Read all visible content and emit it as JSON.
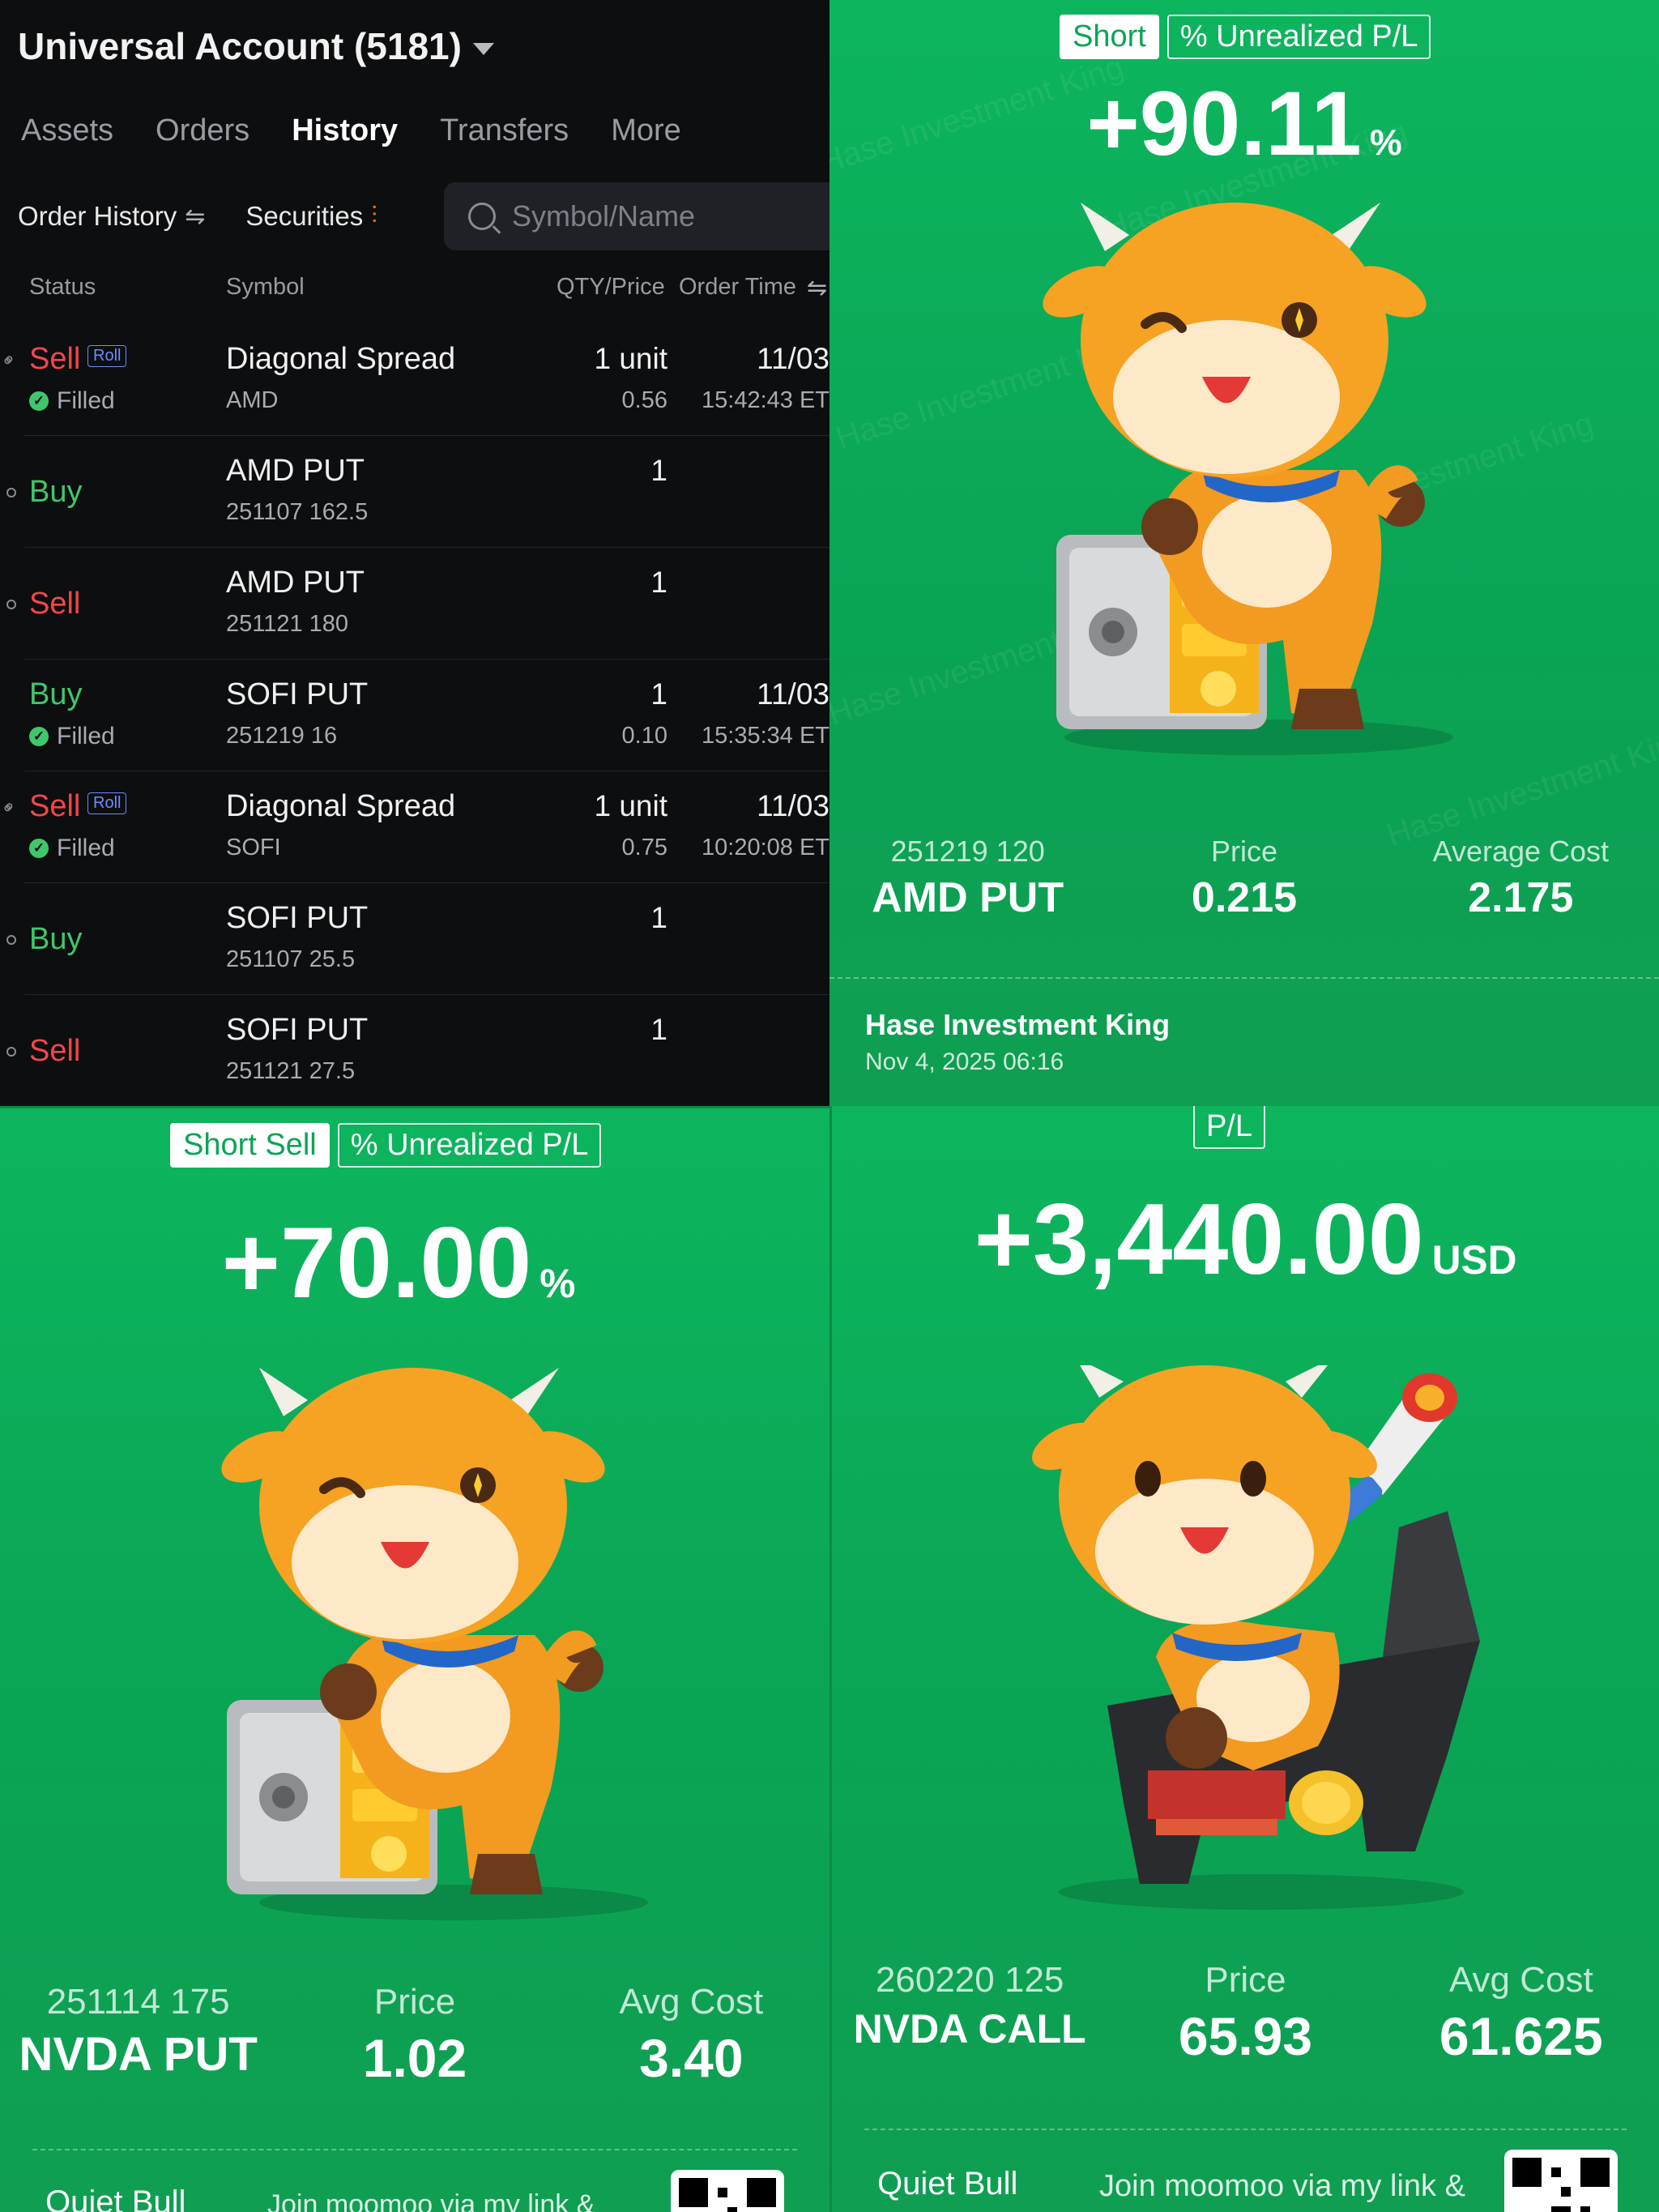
{
  "history": {
    "account_title": "Universal Account (5181)",
    "tabs": [
      "Assets",
      "Orders",
      "History",
      "Transfers",
      "More"
    ],
    "active_tab": "History",
    "filter_order": "Order History",
    "filter_securities": "Securities",
    "search_placeholder": "Symbol/Name",
    "columns": {
      "status": "Status",
      "symbol": "Symbol",
      "qty_price": "QTY/Price",
      "order_time": "Order Time"
    },
    "rows": [
      {
        "side": "Sell",
        "roll": "Roll",
        "status": "Filled",
        "symbol": "Diagonal Spread",
        "sub": "AMD",
        "qty": "1 unit",
        "price": "0.56",
        "date": "11/03",
        "time": "15:42:43 ET"
      },
      {
        "side": "Buy",
        "roll": "",
        "status": "",
        "symbol": "AMD PUT",
        "sub": "251107 162.5",
        "qty": "1",
        "price": "",
        "date": "",
        "time": ""
      },
      {
        "side": "Sell",
        "roll": "",
        "status": "",
        "symbol": "AMD PUT",
        "sub": "251121 180",
        "qty": "1",
        "price": "",
        "date": "",
        "time": ""
      },
      {
        "side": "Buy",
        "roll": "",
        "status": "Filled",
        "symbol": "SOFI PUT",
        "sub": "251219 16",
        "qty": "1",
        "price": "0.10",
        "date": "11/03",
        "time": "15:35:34 ET"
      },
      {
        "side": "Sell",
        "roll": "Roll",
        "status": "Filled",
        "symbol": "Diagonal Spread",
        "sub": "SOFI",
        "qty": "1 unit",
        "price": "0.75",
        "date": "11/03",
        "time": "10:20:08 ET"
      },
      {
        "side": "Buy",
        "roll": "",
        "status": "",
        "symbol": "SOFI PUT",
        "sub": "251107 25.5",
        "qty": "1",
        "price": "",
        "date": "",
        "time": ""
      },
      {
        "side": "Sell",
        "roll": "",
        "status": "",
        "symbol": "SOFI PUT",
        "sub": "251121 27.5",
        "qty": "1",
        "price": "",
        "date": "",
        "time": ""
      }
    ]
  },
  "card_amd": {
    "badge1": "Short",
    "badge2": "% Unrealized P/L",
    "value": "+90.11",
    "unit": "%",
    "contract": "251219 120",
    "symbol": "AMD PUT",
    "price_label": "Price",
    "price": "0.215",
    "cost_label": "Average Cost",
    "cost": "2.175",
    "author": "Hase Investment King",
    "date": "Nov 4, 2025 06:16",
    "watermark": "Hase Investment King"
  },
  "card_nvda_put": {
    "badge1": "Short Sell",
    "badge2": "% Unrealized P/L",
    "value": "+70.00",
    "unit": "%",
    "contract": "251114 175",
    "symbol": "NVDA PUT",
    "price_label": "Price",
    "price": "1.02",
    "cost_label": "Avg Cost",
    "cost": "3.40",
    "author": "Quiet Bull",
    "note": "Join moomoo via my link &"
  },
  "card_nvda_call": {
    "badge1": "P/L",
    "value": "+3,440.00",
    "unit": "USD",
    "contract": "260220 125",
    "symbol": "NVDA CALL",
    "price_label": "Price",
    "price": "65.93",
    "cost_label": "Avg Cost",
    "cost": "61.625",
    "author": "Quiet Bull",
    "note": "Join moomoo via my link &"
  },
  "colors": {
    "sell": "#f2474a",
    "buy": "#3fc76b",
    "accent": "#f56a22",
    "card_green": "#0aa455"
  }
}
